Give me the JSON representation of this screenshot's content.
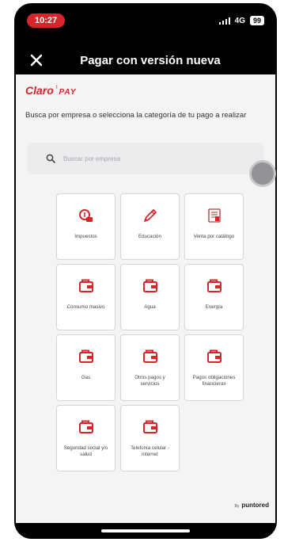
{
  "status_bar": {
    "time": "10:27",
    "network": "4G",
    "battery": "99"
  },
  "header": {
    "title": "Pagar con versión nueva"
  },
  "brand": {
    "name": "Claro",
    "product": "PAY",
    "accent_color": "#d7262b"
  },
  "intro_text": "Busca por empresa o selecciona la categoría de tu pago a realizar",
  "search": {
    "placeholder": "Buscar por empresa"
  },
  "categories": [
    {
      "label": "Impuestos",
      "icon": "tax-money-icon"
    },
    {
      "label": "Educación",
      "icon": "pencil-icon"
    },
    {
      "label": "Venta por catálogo",
      "icon": "catalog-icon"
    },
    {
      "label": "Consumo masivo",
      "icon": "wallet-icon"
    },
    {
      "label": "Agua",
      "icon": "wallet-icon"
    },
    {
      "label": "Energía",
      "icon": "wallet-icon"
    },
    {
      "label": "Gas",
      "icon": "wallet-icon"
    },
    {
      "label": "Otros pagos y servicios",
      "icon": "wallet-icon"
    },
    {
      "label": "Pagos obligaciones financieras",
      "icon": "wallet-icon"
    },
    {
      "label": "Seguridad social y/o salud",
      "icon": "wallet-icon"
    },
    {
      "label": "Telefonía celular - internet",
      "icon": "wallet-icon"
    }
  ],
  "footer": {
    "by": "By",
    "provider": "puntored"
  }
}
